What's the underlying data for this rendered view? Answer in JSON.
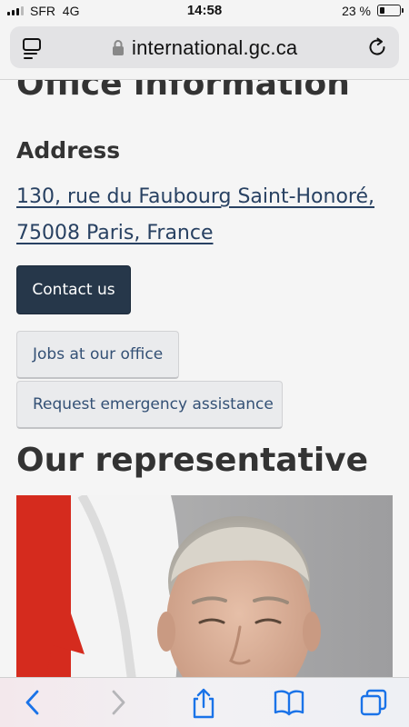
{
  "status_bar": {
    "carrier": "SFR",
    "network": "4G",
    "time": "14:58",
    "battery_percent": "23 %",
    "battery_level": 0.23,
    "signal_bars": 4,
    "signal_bars_active": 3
  },
  "url_bar": {
    "domain": "international.gc.ca",
    "icons": [
      "reader-view-icon",
      "lock-icon",
      "reload-icon"
    ]
  },
  "page": {
    "section_title": "Office information",
    "address_heading": "Address",
    "address_line1": "130, rue du Faubourg Saint-Honoré,",
    "address_line2": "75008 Paris, France",
    "contact_button": "Contact us",
    "jobs_button": "Jobs at our office",
    "emergency_button": "Request emergency assistance",
    "representative_heading": "Our representative"
  },
  "colors": {
    "heading": "#333333",
    "link": "#284162",
    "primary_button": "#26374a",
    "secondary_button_text": "#335075",
    "flag_red": "#d52b1e"
  },
  "toolbar": {
    "icons": [
      "back-icon",
      "forward-icon",
      "share-icon",
      "bookmarks-icon",
      "tabs-icon"
    ]
  }
}
